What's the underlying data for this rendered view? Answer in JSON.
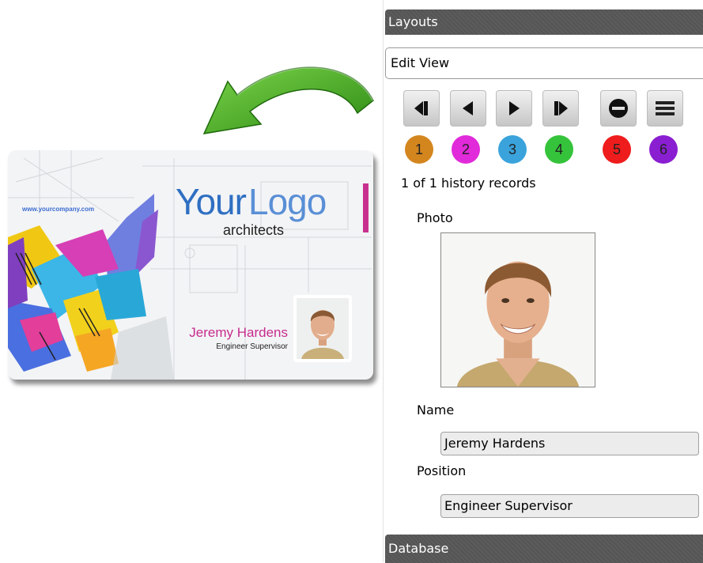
{
  "card": {
    "url": "www.yourcompany.com",
    "logo_your": "Your",
    "logo_logo": "Logo",
    "logo_sub": "architects",
    "name": "Jeremy Hardens",
    "position": "Engineer Supervisor"
  },
  "panel": {
    "layouts_title": "Layouts",
    "view_selected": "Edit View",
    "nav_buttons": [
      {
        "icon": "first-record-icon"
      },
      {
        "icon": "previous-record-icon"
      },
      {
        "icon": "next-record-icon"
      },
      {
        "icon": "last-record-icon"
      },
      {
        "icon": "delete-record-icon"
      },
      {
        "icon": "list-menu-icon"
      }
    ],
    "badges": [
      {
        "label": "1",
        "color": "#d4861e"
      },
      {
        "label": "2",
        "color": "#e12ad9"
      },
      {
        "label": "3",
        "color": "#3aa3dc"
      },
      {
        "label": "4",
        "color": "#35c33b"
      },
      {
        "label": "5",
        "color": "#ee1c1c"
      },
      {
        "label": "6",
        "color": "#8a1ed1"
      }
    ],
    "history_text": "1 of 1 history records",
    "photo_label": "Photo",
    "name_label": "Name",
    "name_value": "Jeremy Hardens",
    "position_label": "Position",
    "position_value": "Engineer Supervisor",
    "database_title": "Database"
  },
  "colors": {
    "header_bg": "#555555",
    "accent_pink": "#c72c8c",
    "logo_blue": "#2f6fc2",
    "arrow_green": "#3a9d1c"
  }
}
